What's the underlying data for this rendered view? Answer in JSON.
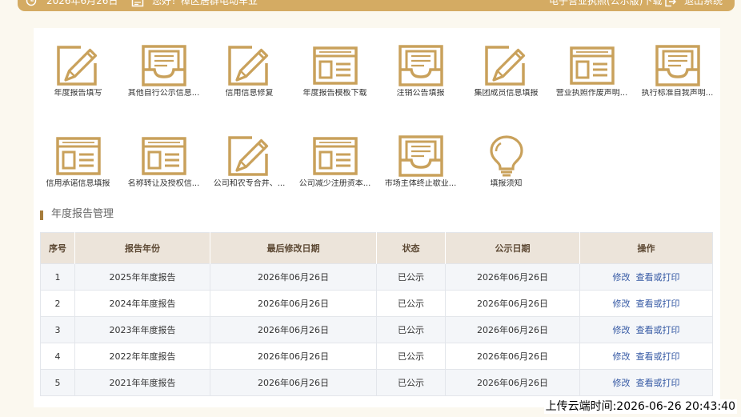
{
  "topbar": {
    "date": "2026年6月26日",
    "greeting": "您好！樟区居群电动车业",
    "license_download": "电子营业执照(公示版)下载",
    "logout": "退出系统"
  },
  "menu": [
    {
      "label": "年度报告填写",
      "icon": "edit-icon"
    },
    {
      "label": "其他自行公示信息...",
      "icon": "inbox-icon"
    },
    {
      "label": "信用信息修复",
      "icon": "edit-icon"
    },
    {
      "label": "年度报告模板下载",
      "icon": "form-icon"
    },
    {
      "label": "注销公告填报",
      "icon": "inbox-icon"
    },
    {
      "label": "集团成员信息填报",
      "icon": "edit-icon"
    },
    {
      "label": "营业执照作废声明...",
      "icon": "form-icon"
    },
    {
      "label": "执行标准自我声明...",
      "icon": "inbox-icon"
    },
    {
      "label": "信用承诺信息填报",
      "icon": "form-icon"
    },
    {
      "label": "名称转让及授权信...",
      "icon": "form-icon"
    },
    {
      "label": "公司和农专合并、...",
      "icon": "edit-icon"
    },
    {
      "label": "公司减少注册资本...",
      "icon": "form-icon"
    },
    {
      "label": "市场主体终止歇业...",
      "icon": "inbox-icon"
    },
    {
      "label": "填报须知",
      "icon": "lightbulb-icon"
    }
  ],
  "section_title": "年度报告管理",
  "table": {
    "columns": [
      "序号",
      "报告年份",
      "最后修改日期",
      "状态",
      "公示日期",
      "操作"
    ],
    "rows": [
      {
        "no": "1",
        "year": "2025年年度报告",
        "modified": "2026年06月26日",
        "status": "已公示",
        "published": "2026年06月26日",
        "actions": [
          "修改",
          "查看或打印"
        ]
      },
      {
        "no": "2",
        "year": "2024年年度报告",
        "modified": "2026年06月26日",
        "status": "已公示",
        "published": "2026年06月26日",
        "actions": [
          "修改",
          "查看或打印"
        ]
      },
      {
        "no": "3",
        "year": "2023年年度报告",
        "modified": "2026年06月26日",
        "status": "已公示",
        "published": "2026年06月26日",
        "actions": [
          "修改",
          "查看或打印"
        ]
      },
      {
        "no": "4",
        "year": "2022年年度报告",
        "modified": "2026年06月26日",
        "status": "已公示",
        "published": "2026年06月26日",
        "actions": [
          "修改",
          "查看或打印"
        ]
      },
      {
        "no": "5",
        "year": "2021年年度报告",
        "modified": "2026年06月26日",
        "status": "已公示",
        "published": "2026年06月26日",
        "actions": [
          "修改",
          "查看或打印"
        ]
      }
    ]
  },
  "upload_time": "上传云端时间:2026-06-26 20:43:40",
  "colors": {
    "topbar": "#d4ab63",
    "icon_gold": "#c9a15b",
    "table_header_bg": "#ece4da",
    "link": "#3559a4",
    "page_bg": "#fbf8ef"
  }
}
